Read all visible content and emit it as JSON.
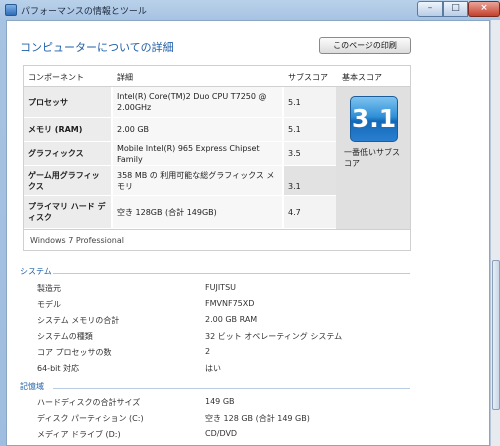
{
  "window": {
    "title": "パフォーマンスの情報とツール",
    "minimize": "–",
    "maximize": "□",
    "close": "×"
  },
  "header": {
    "title": "コンピューターについての詳細",
    "print_label": "このページの印刷"
  },
  "score_table": {
    "columns": [
      "コンポーネント",
      "詳細",
      "サブスコア",
      "基本スコア"
    ],
    "rows": [
      {
        "component": "プロセッサ",
        "detail": "Intel(R) Core(TM)2 Duo CPU T7250 @ 2.00GHz",
        "subscore": "5.1"
      },
      {
        "component": "メモリ (RAM)",
        "detail": "2.00 GB",
        "subscore": "5.1"
      },
      {
        "component": "グラフィックス",
        "detail": "Mobile Intel(R) 965 Express Chipset Family",
        "subscore": "3.5"
      },
      {
        "component": "ゲーム用グラフィックス",
        "detail": "358 MB の 利用可能な総グラフィックス メモリ",
        "subscore": "3.1"
      },
      {
        "component": "プライマリ ハード ディスク",
        "detail": "空き 128GB (合計 149GB)",
        "subscore": "4.7"
      }
    ],
    "base_score": "3.1",
    "base_caption": "一番低いサブスコア",
    "os": "Windows 7 Professional"
  },
  "system": {
    "title": "システム",
    "items": [
      {
        "label": "製造元",
        "value": "FUJITSU"
      },
      {
        "label": "モデル",
        "value": "FMVNF75XD"
      },
      {
        "label": "システム メモリの合計",
        "value": "2.00 GB RAM"
      },
      {
        "label": "システムの種類",
        "value": "32 ビット オペレーティング システム"
      },
      {
        "label": "コア プロセッサの数",
        "value": "2"
      },
      {
        "label": "64-bit 対応",
        "value": "はい"
      }
    ]
  },
  "storage": {
    "title": "記憶域",
    "items": [
      {
        "label": "ハードディスクの合計サイズ",
        "value": "149 GB"
      },
      {
        "label": "ディスク パーティション (C:)",
        "value": "空き 128 GB (合計 149 GB)"
      },
      {
        "label": "メディア ドライブ (D:)",
        "value": "CD/DVD"
      }
    ]
  }
}
